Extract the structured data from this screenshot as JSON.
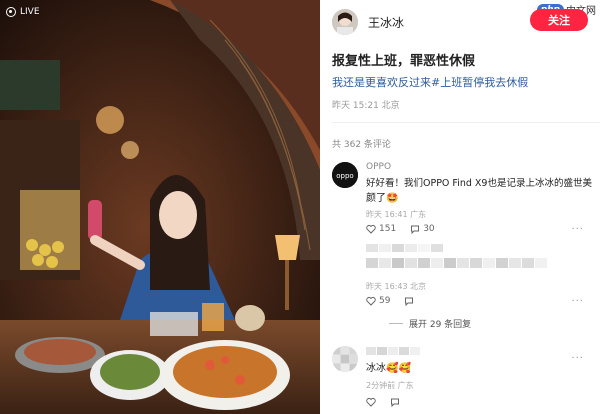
{
  "photo": {
    "live_label": "LIVE"
  },
  "header": {
    "username": "王冰冰",
    "follow_label": "关注",
    "watermark_site": "php",
    "watermark_text": "中文网"
  },
  "post": {
    "title": "报复性上班，罪恶性休假",
    "body": "我还是更喜欢反过来#上班暂停我去休假",
    "meta": "昨天 15:21 北京",
    "comment_count": "共 362 条评论"
  },
  "comments": [
    {
      "name": "OPPO",
      "line1": "好好看！我们OPPO Find X9也是记录上冰冰的盛世美",
      "line2": "颜了🤩",
      "meta": "昨天 16:41 广东",
      "likes": "151",
      "replies": "30",
      "avatar_text": "oppo"
    },
    {
      "name": "",
      "meta": "昨天 16:43 北京",
      "likes": "59",
      "replies": ""
    },
    {
      "name": "",
      "text": "冰冰🥰🥰",
      "meta": "2分钟前 广东",
      "likes": "",
      "replies": ""
    }
  ],
  "expand_label": "展开 29 条回复",
  "colors": {
    "accent": "#ff2442",
    "link": "#2f5c9e",
    "muted": "#999999"
  },
  "icons": [
    "live-icon",
    "heart-icon",
    "comment-icon",
    "more-icon"
  ]
}
